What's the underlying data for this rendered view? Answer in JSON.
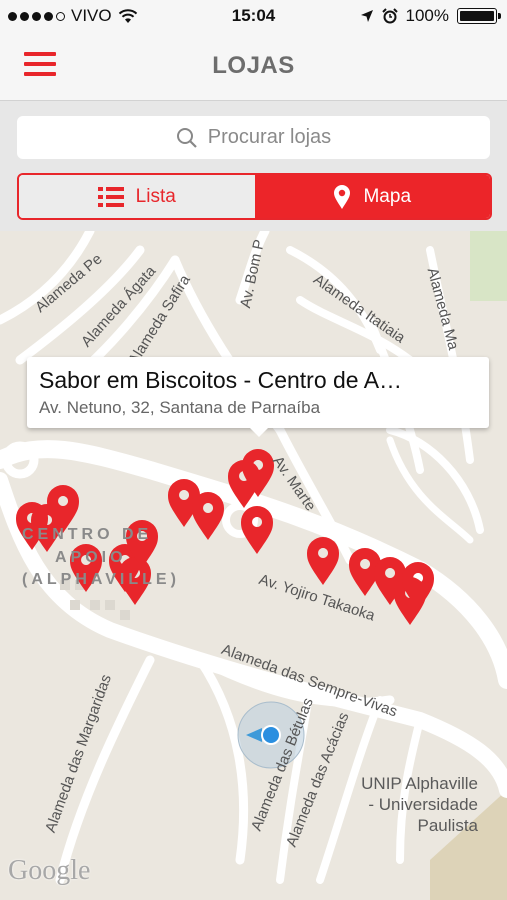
{
  "status_bar": {
    "carrier": "VIVO",
    "time": "15:04",
    "battery_percent": "100%",
    "signal_bars": 4,
    "icons": [
      "wifi-icon",
      "location-arrow-icon",
      "alarm-icon",
      "battery-icon"
    ]
  },
  "navbar": {
    "title": "LOJAS",
    "menu_icon": "hamburger-menu-icon"
  },
  "search": {
    "placeholder": "Procurar lojas",
    "icon": "search-icon"
  },
  "segments": {
    "lista_label": "Lista",
    "mapa_label": "Mapa",
    "selected": "Mapa",
    "lista_icon": "list-icon",
    "mapa_icon": "map-pin-icon"
  },
  "map": {
    "callout": {
      "title": "Sabor em Biscoitos - Centro de A…",
      "subtitle": "Av. Netuno, 32, Santana de Parnaíba"
    },
    "streets": {
      "s1": "Alameda Pe",
      "s2": "Alameda Ágata",
      "s3": "Alameda Safira",
      "s4": "Av. Bom P",
      "s5": "Alameda Itatiaia",
      "s6": "Alameda Ma",
      "s7": "Av. Marte",
      "s8": "Av. Yojiro Takaoka",
      "s9": "Alameda das Sempre-Vivas",
      "s10": "Alameda das Margaridas",
      "s11": "Alameda das Bétulas",
      "s12": "Alameda das Acácias"
    },
    "district_line1": "CENTRO DE",
    "district_line2": "APOIO",
    "district_line3": "(ALPHAVILLE)",
    "poi_line1": "UNIP Alphaville",
    "poi_line2": "- Universidade",
    "poi_line3": "Paulista",
    "attribution": "Google",
    "accent_color": "#e8262b",
    "store_pin_count": 24
  }
}
